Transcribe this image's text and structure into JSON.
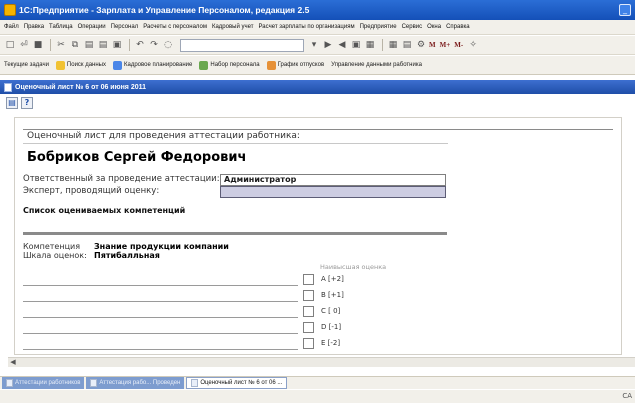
{
  "window": {
    "title": "1С:Предприятие - Зарплата и Управление Персоналом, редакция 2.5"
  },
  "menu": [
    "Файл",
    "Правка",
    "Таблица",
    "Операции",
    "Персонал",
    "Расчеты с персоналом",
    "Кадровый учет",
    "Расчет зарплаты по организациям",
    "Предприятие",
    "Сервис",
    "Окна",
    "Справка"
  ],
  "toolbar2": {
    "items": [
      "Текущие задачи",
      "Поиск данных",
      "Кадровое планирование",
      "Набор персонала",
      "График отпусков",
      "Управление данными работника"
    ]
  },
  "document": {
    "title": "Оценочный лист № 6 от 06 июня 2011",
    "help_label": "?",
    "caption": "Оценочный лист для проведения аттестации работника:",
    "employee_name": "Бобриков Сергей Федорович",
    "responsible_label": "Ответственный за проведение аттестации:",
    "responsible_value": "Администратор",
    "expert_label": "Эксперт, проводящий оценку:",
    "expert_value": "",
    "list_caption": "Список оцениваемых компетенций",
    "competence_label": "Компетенция",
    "competence_value": "Знание продукции компании",
    "scale_label": "Шкала оценок:",
    "scale_value": "Пятибалльная",
    "max_hint": "Наивысшая оценка",
    "options": [
      "A [+2]",
      "B [+1]",
      "C [ 0]",
      "D [-1]",
      "E [-2]"
    ]
  },
  "taskbar": {
    "items": [
      "Аттестации работников",
      "Аттестация рабо... Проведен",
      "Оценочный лист № 6 от 06 ..."
    ]
  },
  "status": {
    "text": "CA"
  },
  "colors": {
    "titlebar": "#1f5fcf",
    "accent": "#3d6fd0",
    "expert_field": "#cdcde2"
  }
}
